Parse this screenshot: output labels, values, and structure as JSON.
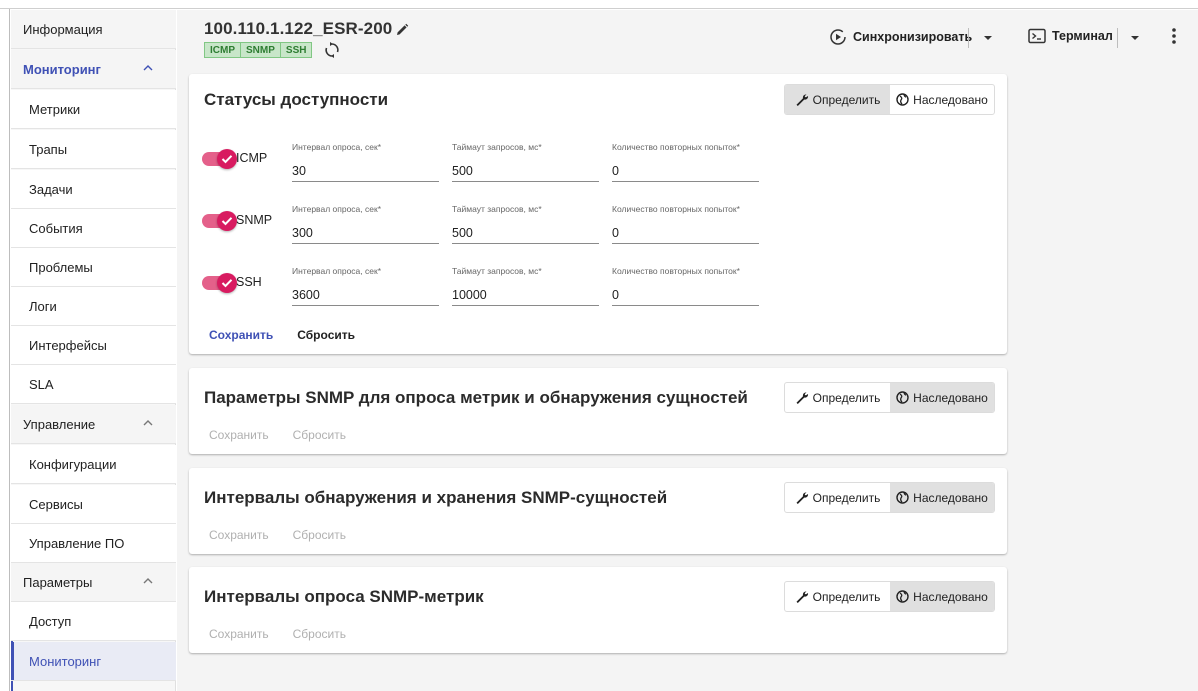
{
  "sidebar": {
    "info": "Информация",
    "groups": [
      {
        "label": "Мониторинг",
        "items": [
          "Метрики",
          "Трапы",
          "Задачи",
          "События",
          "Проблемы",
          "Логи",
          "Интерфейсы",
          "SLA"
        ]
      },
      {
        "label": "Управление",
        "items": [
          "Конфигурации",
          "Сервисы",
          "Управление ПО"
        ]
      },
      {
        "label": "Параметры",
        "items": [
          "Доступ",
          "Мониторинг"
        ]
      }
    ],
    "selected_item": "Мониторинг"
  },
  "header": {
    "device_title": "100.110.1.122_ESR-200",
    "tags": [
      "ICMP",
      "SNMP",
      "SSH"
    ],
    "sync_label": "Синхронизировать",
    "terminal_label": "Терминал"
  },
  "accent_color": "#3f51b5",
  "toggle_color": "#d81b60",
  "cards": [
    {
      "title": "Статусы доступности",
      "mode_define": "Определить",
      "mode_inherit": "Наследовано",
      "active_mode": "define",
      "save": "Сохранить",
      "reset": "Сбросить",
      "rows": [
        {
          "protocol": "ICMP",
          "enabled": true,
          "interval_label": "Интервал опроса, сек*",
          "interval": "30",
          "timeout_label": "Таймаут запросов, мс*",
          "timeout": "500",
          "retries_label": "Количество повторных попыток*",
          "retries": "0"
        },
        {
          "protocol": "SNMP",
          "enabled": true,
          "interval_label": "Интервал опроса, сек*",
          "interval": "300",
          "timeout_label": "Таймаут запросов, мс*",
          "timeout": "500",
          "retries_label": "Количество повторных попыток*",
          "retries": "0"
        },
        {
          "protocol": "SSH",
          "enabled": true,
          "interval_label": "Интервал опроса, сек*",
          "interval": "3600",
          "timeout_label": "Таймаут запросов, мс*",
          "timeout": "10000",
          "retries_label": "Количество повторных попыток*",
          "retries": "0"
        }
      ]
    },
    {
      "title": "Параметры SNMP для опроса метрик и обнаружения сущностей",
      "mode_define": "Определить",
      "mode_inherit": "Наследовано",
      "active_mode": "inherit",
      "save": "Сохранить",
      "reset": "Сбросить"
    },
    {
      "title": "Интервалы обнаружения и хранения SNMP-сущностей",
      "mode_define": "Определить",
      "mode_inherit": "Наследовано",
      "active_mode": "inherit",
      "save": "Сохранить",
      "reset": "Сбросить"
    },
    {
      "title": "Интервалы опроса SNMP-метрик",
      "mode_define": "Определить",
      "mode_inherit": "Наследовано",
      "active_mode": "inherit",
      "save": "Сохранить",
      "reset": "Сбросить"
    }
  ]
}
